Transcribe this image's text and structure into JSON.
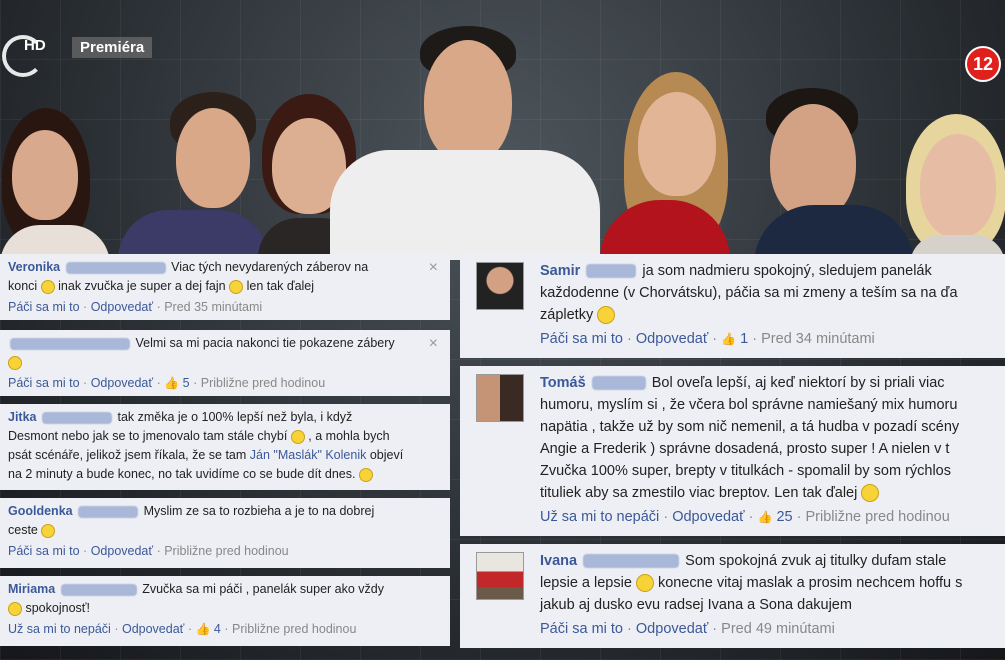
{
  "header": {
    "logo_text": "HD",
    "premiere_label": "Premiéra",
    "age_rating": "12"
  },
  "left_comments": [
    {
      "name": "Veronika",
      "text1": "Viac tých nevydarených záberov na",
      "text2": "konci",
      "text3": "inak zvučka je super a dej fajn",
      "text4": "len tak ďalej",
      "like": "Páči sa mi to",
      "reply": "Odpovedať",
      "time": "Pred 35 minútami",
      "sep": "·",
      "close": "×"
    },
    {
      "text1": "Velmi sa mi pacia nakonci tie pokazene zábery",
      "like": "Páči sa mi to",
      "reply": "Odpovedať",
      "likes": "5",
      "time": "Približne pred hodinou",
      "sep": "·",
      "close": "×"
    },
    {
      "name": "Jitka",
      "text1": "tak změka je o 100% lepší než byla, i když",
      "text2": "Desmont nebo jak se to jmenovalo tam stále chybí",
      "text3": ", a mohla bych",
      "text4": "psát scénáře, jelikož jsem říkala, že se tam",
      "link": "Ján \"Maslák\" Kolenik",
      "text5": "objeví",
      "text6": "na 2 minuty a bude konec, no tak uvidíme co se bude dít dnes."
    },
    {
      "name": "Gooldenka",
      "text1": "Myslim ze sa to rozbieha a je to na dobrej",
      "text2": "ceste",
      "like": "Páči sa mi to",
      "reply": "Odpovedať",
      "time": "Približne pred hodinou",
      "sep": "·"
    },
    {
      "name": "Miriama",
      "text1": "Zvučka sa mi páči , panelák super ako vždy",
      "text2": "spokojnosť!",
      "like": "Už sa mi to nepáči",
      "reply": "Odpovedať",
      "likes": "4",
      "time": "Približne pred hodinou",
      "sep": "·"
    }
  ],
  "right_comments": [
    {
      "name": "Samir",
      "text1": "ja som nadmieru spokojný, sledujem panelák",
      "text2": "každodenne (v Chorvátsku), páčia sa mi zmeny a teším sa na ďa",
      "text3": "zápletky",
      "like": "Páči sa mi to",
      "reply": "Odpovedať",
      "likes": "1",
      "time": "Pred 34 minútami",
      "sep": "·"
    },
    {
      "name": "Tomáš",
      "text1": "Bol oveľa lepší, aj keď niektorí by si priali viac",
      "text2": "humoru, myslím si , že včera bol správne namiešaný mix humoru",
      "text3": "napätia , takže už by som nič nemenil, a tá hudba v pozadí scény",
      "text4": "Angie a Frederik ) správne dosadená, prosto super ! A nielen v t",
      "text5": "Zvučka 100% super, brepty v titulkách - spomalil by som rýchlos",
      "text6": "tituliek aby sa zmestilo viac breptov. Len tak ďalej",
      "like": "Už sa mi to nepáči",
      "reply": "Odpovedať",
      "likes": "25",
      "time": "Približne pred hodinou",
      "sep": "·"
    },
    {
      "name": "Ivana",
      "text1": "Som spokojná zvuk aj titulky dufam stale",
      "text2": "lepsie a lepsie",
      "text3": "konecne vitaj maslak a prosim nechcem hoffu s",
      "text4": "jakub aj dusko evu radsej Ivana a Sona dakujem",
      "like": "Páči sa mi to",
      "reply": "Odpovedať",
      "time": "Pred 49 minútami",
      "sep": "·"
    }
  ]
}
